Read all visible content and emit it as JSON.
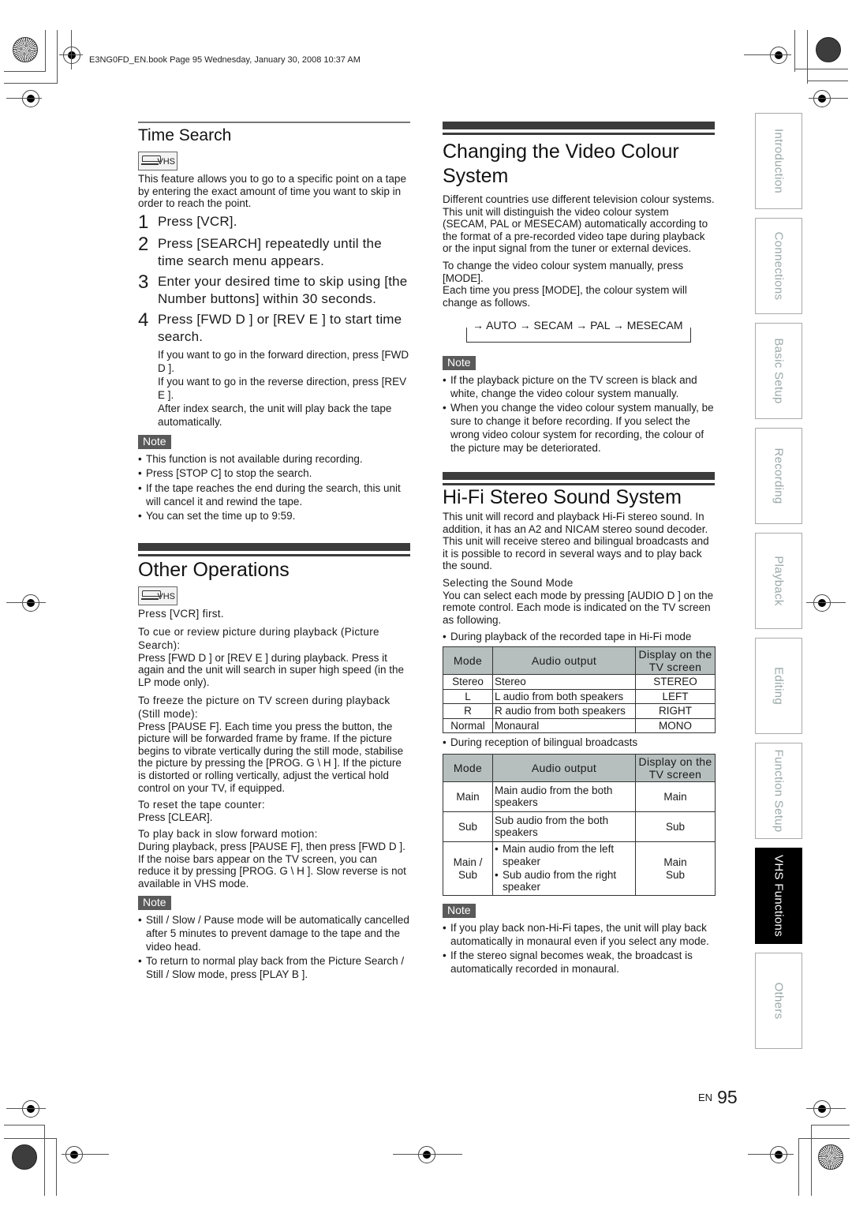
{
  "print_header": "E3NG0FD_EN.book  Page 95  Wednesday, January 30, 2008  10:37 AM",
  "vhs_badge": "VHS",
  "time_search": {
    "title": "Time Search",
    "intro": "This feature allows you to go to a specific point on a tape by entering the exact amount of time you want to skip in order to reach the point.",
    "steps": [
      {
        "num": "1",
        "text": "Press [VCR]."
      },
      {
        "num": "2",
        "text": "Press [SEARCH] repeatedly until the time search menu appears."
      },
      {
        "num": "3",
        "text": "Enter your desired time to skip using [the Number buttons] within 30 seconds."
      },
      {
        "num": "4",
        "text": "Press [FWD D   ] or [REV E   ] to start time search."
      }
    ],
    "step4_details": [
      "If you want to go in the forward direction, press [FWD D   ].",
      "If you want to go in the reverse direction, press [REV E   ].",
      "After index search, the unit will play back the tape automatically."
    ],
    "note_label": "Note",
    "notes": [
      "This function is not available during recording.",
      "Press [STOP C] to stop the search.",
      "If the tape reaches the end during the search, this unit will cancel it and rewind the tape.",
      "You can set the time up to 9:59."
    ]
  },
  "other_operations": {
    "title": "Other Operations",
    "first": "Press [VCR] first.",
    "blocks": [
      {
        "heading": "To cue or review picture during playback (Picture Search):",
        "body": "Press [FWD D   ] or [REV E   ] during playback. Press it again and the unit will search in super high speed (in the LP mode only)."
      },
      {
        "heading": "To freeze the picture on TV screen during playback (Still mode):",
        "body": "Press [PAUSE F]. Each time you press the button, the picture will be forwarded frame by frame. If the picture begins to vibrate vertically during the still mode, stabilise the picture by pressing the [PROG. G \\ H    ]. If the picture is distorted or rolling vertically, adjust the vertical hold control on your TV, if equipped."
      },
      {
        "heading": "To reset the tape counter:",
        "body": "Press [CLEAR]."
      },
      {
        "heading": "To play back in slow forward motion:",
        "body": "During playback, press [PAUSE F], then press [FWD D   ]. If the noise bars appear on the TV screen, you can reduce it by pressing [PROG. G \\ H    ]. Slow reverse is not available in VHS mode."
      }
    ],
    "note_label": "Note",
    "notes": [
      "Still / Slow / Pause mode will be automatically cancelled after 5 minutes to prevent damage to the tape and the video head.",
      "To return to normal play back from the Picture Search / Still / Slow mode, press [PLAY B ]."
    ]
  },
  "colour_system": {
    "title": "Changing the Video Colour System",
    "para1": "Different countries use different television colour systems.",
    "para2": "This unit will distinguish the video colour system (SECAM, PAL or MESECAM) automatically according to the format of a pre-recorded video tape during playback or the input signal from the tuner or external devices.",
    "para3": "To change the video colour system manually, press [MODE].",
    "para4": "Each time you press [MODE], the colour system will change as follows.",
    "cycle": "→ AUTO → SECAM → PAL → MESECAM",
    "note_label": "Note",
    "notes": [
      "If the playback picture on the TV screen is black and white, change the video colour system manually.",
      "When you change the video colour system manually, be sure to change it before recording. If you select the wrong video colour system for recording, the colour of the picture may be deteriorated."
    ]
  },
  "hifi": {
    "title": "Hi-Fi Stereo Sound System",
    "intro": "This unit will record and playback Hi-Fi stereo sound. In addition, it has an A2 and NICAM stereo sound decoder. This unit will receive stereo and bilingual broadcasts and it is possible to record in several ways and to play back the sound.",
    "sub_heading": "Selecting the Sound Mode",
    "sub_body": "You can select each mode by pressing [AUDIO D   ] on the remote control. Each mode is indicated on the TV screen as following.",
    "table1_caption": "During playback of the recorded tape in Hi-Fi mode",
    "table_headers": [
      "Mode",
      "Audio output",
      "Display on the TV screen"
    ],
    "table1_rows": [
      [
        "Stereo",
        "Stereo",
        "STEREO"
      ],
      [
        "L",
        "L audio from both speakers",
        "LEFT"
      ],
      [
        "R",
        "R audio from both speakers",
        "RIGHT"
      ],
      [
        "Normal",
        "Monaural",
        "MONO"
      ]
    ],
    "table2_caption": "During reception of bilingual broadcasts",
    "table2_rows": [
      [
        "Main",
        "Main audio from the both speakers",
        "Main"
      ],
      [
        "Sub",
        "Sub audio from the both speakers",
        "Sub"
      ]
    ],
    "table2_mainsub": {
      "mode": "Main / Sub",
      "outputs": [
        "Main audio from the left speaker",
        "Sub audio from the right speaker"
      ],
      "display": "Main Sub"
    },
    "note_label": "Note",
    "notes": [
      "If you play back non-Hi-Fi tapes, the unit will play back automatically in monaural even if you select any mode.",
      "If the stereo signal becomes weak, the broadcast is automatically recorded in monaural."
    ]
  },
  "side_tabs": [
    {
      "label": "Introduction",
      "active": false
    },
    {
      "label": "Connections",
      "active": false
    },
    {
      "label": "Basic Setup",
      "active": false
    },
    {
      "label": "Recording",
      "active": false
    },
    {
      "label": "Playback",
      "active": false
    },
    {
      "label": "Editing",
      "active": false
    },
    {
      "label": "Function Setup",
      "active": false
    },
    {
      "label": "VHS Functions",
      "active": true
    },
    {
      "label": "Others",
      "active": false
    }
  ],
  "footer": {
    "lang": "EN",
    "page": "95"
  }
}
